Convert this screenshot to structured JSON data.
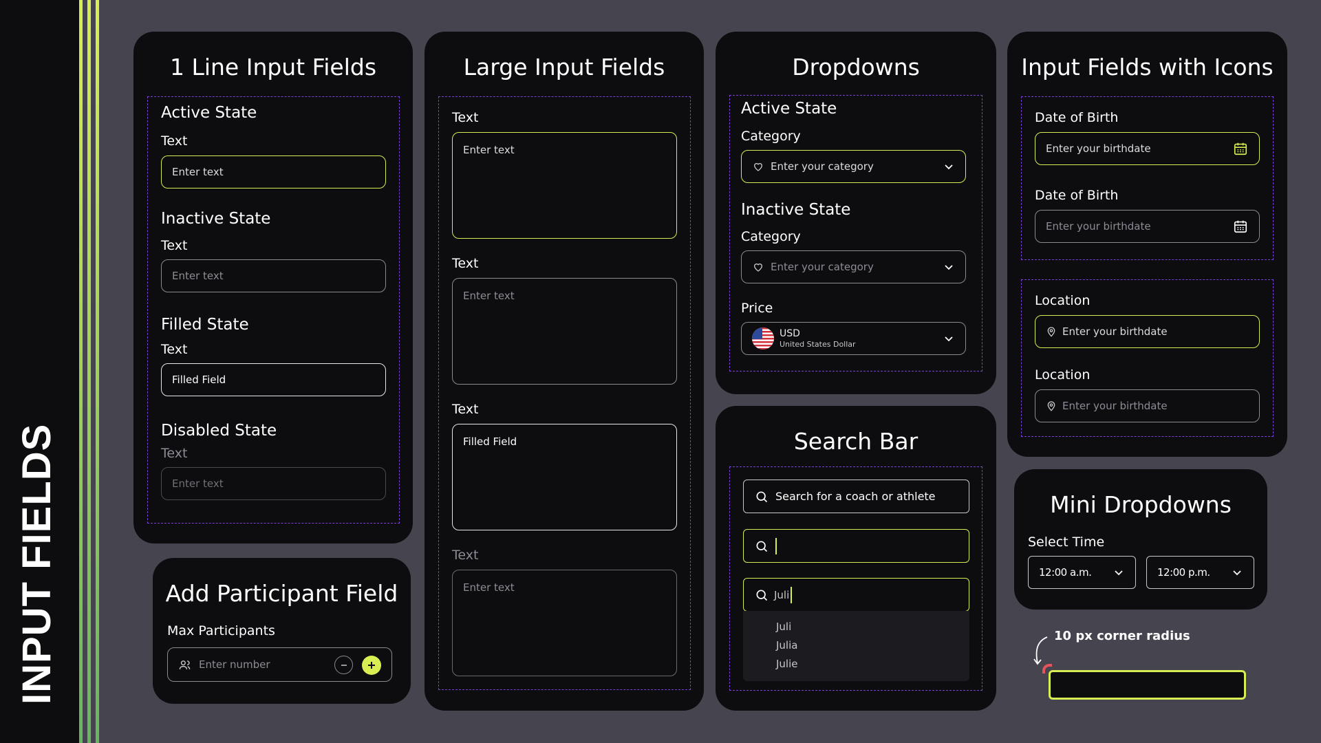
{
  "page": {
    "side_title": "INPUT FIELDS"
  },
  "colors": {
    "accent": "#d8ee52",
    "card": "#0d0d0f",
    "background": "#45444f",
    "dash": "#7e3fd9"
  },
  "one_line": {
    "title": "1 Line Input Fields",
    "active": {
      "state": "Active State",
      "label": "Text",
      "placeholder": "Enter text"
    },
    "inactive": {
      "state": "Inactive State",
      "label": "Text",
      "placeholder": "Enter text"
    },
    "filled": {
      "state": "Filled State",
      "label": "Text",
      "value": "Filled Field"
    },
    "disabled": {
      "state": "Disabled State",
      "label": "Text",
      "placeholder": "Enter text"
    }
  },
  "large": {
    "title": "Large Input Fields",
    "fields": [
      {
        "label": "Text",
        "text": "Enter text"
      },
      {
        "label": "Text",
        "text": "Enter text"
      },
      {
        "label": "Text",
        "text": "Filled Field"
      },
      {
        "label": "Text",
        "text": "Enter text"
      }
    ]
  },
  "dropdowns": {
    "title": "Dropdowns",
    "active": {
      "state": "Active State",
      "label": "Category",
      "placeholder": "Enter your category"
    },
    "inactive": {
      "state": "Inactive State",
      "label": "Category",
      "placeholder": "Enter your category"
    },
    "price": {
      "label": "Price",
      "currency": "USD",
      "currency_name": "United States Dollar"
    }
  },
  "search_bar": {
    "title": "Search Bar",
    "placeholder": "Search for a coach or athlete",
    "typed": "Juli",
    "suggestions": [
      "Juli",
      "Julia",
      "Julie"
    ]
  },
  "icons_fields": {
    "title": "Input Fields with Icons",
    "dob1": {
      "label": "Date of Birth",
      "placeholder": "Enter your birthdate"
    },
    "dob2": {
      "label": "Date of Birth",
      "placeholder": "Enter your birthdate"
    },
    "loc1": {
      "label": "Location",
      "placeholder": "Enter your birthdate"
    },
    "loc2": {
      "label": "Location",
      "placeholder": "Enter your birthdate"
    }
  },
  "participants": {
    "title": "Add Participant Field",
    "label": "Max Participants",
    "placeholder": "Enter number"
  },
  "mini_dropdowns": {
    "title": "Mini Dropdowns",
    "label": "Select Time",
    "options": [
      "12:00 a.m.",
      "12:00 p.m."
    ]
  },
  "note": {
    "text": "10 px corner radius"
  }
}
